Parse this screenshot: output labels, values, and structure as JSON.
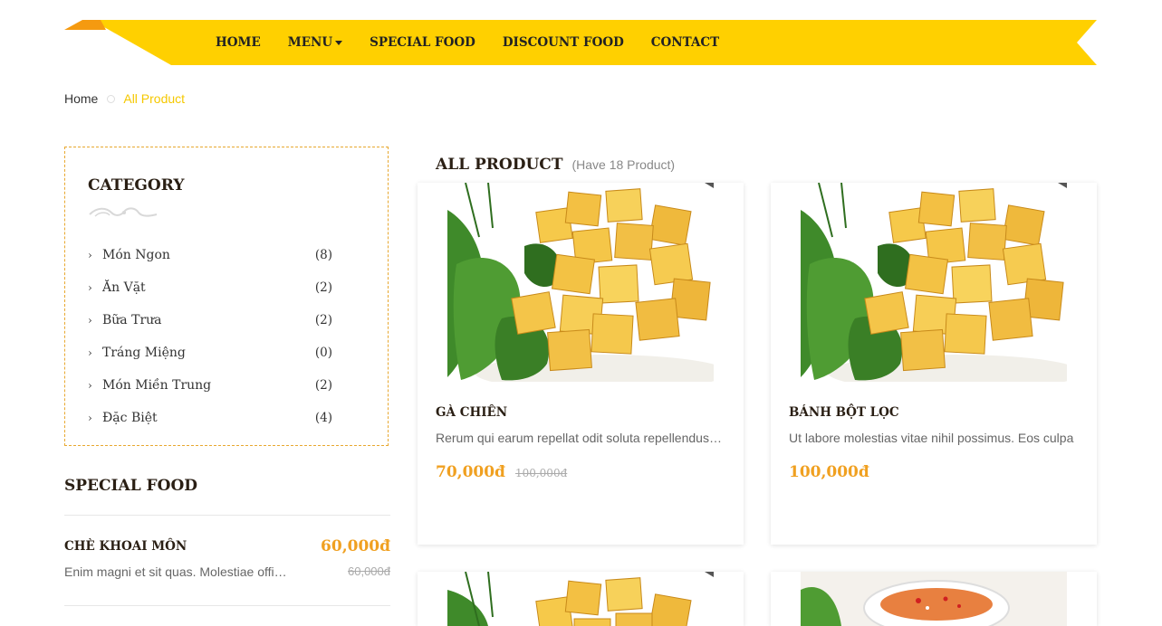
{
  "nav": {
    "items": [
      {
        "label": "HOME"
      },
      {
        "label": "MENU"
      },
      {
        "label": "SPECIAL FOOD"
      },
      {
        "label": "DISCOUNT FOOD"
      },
      {
        "label": "CONTACT"
      }
    ],
    "bar_color": "#ffd000",
    "accent_color": "#f59a10"
  },
  "breadcrumb": {
    "home": "Home",
    "current": "All Product"
  },
  "category": {
    "title": "CATEGORY",
    "items": [
      {
        "label": "Món Ngon",
        "count": "(8)"
      },
      {
        "label": "Ăn Vặt",
        "count": "(2)"
      },
      {
        "label": "Bữa Trưa",
        "count": "(2)"
      },
      {
        "label": "Tráng Miệng",
        "count": "(0)"
      },
      {
        "label": "Món Miền Trung",
        "count": "(2)"
      },
      {
        "label": "Đặc Biệt",
        "count": "(4)"
      }
    ]
  },
  "special_food": {
    "title": "SPECIAL FOOD",
    "items": [
      {
        "name": "CHÈ KHOAI MÔN",
        "price": "60,000đ",
        "old_price": "60,000đ",
        "desc": "Enim magni et sit quas. Molestiae officiis"
      }
    ]
  },
  "products": {
    "title": "ALL PRODUCT",
    "count_text": "(Have 18 Product)",
    "items": [
      {
        "name": "GÀ CHIÊN",
        "desc": "Rerum qui earum repellat odit soluta repellendus dolore",
        "price": "70,000đ",
        "old_price": "100,000đ"
      },
      {
        "name": "BÁNH BỘT LỌC",
        "desc": "Ut labore molestias vitae nihil possimus. Eos culpa",
        "price": "100,000đ",
        "old_price": ""
      }
    ]
  },
  "colors": {
    "price": "#f0a020",
    "breadcrumb_current": "#f5c800",
    "category_border": "#e8a830"
  }
}
